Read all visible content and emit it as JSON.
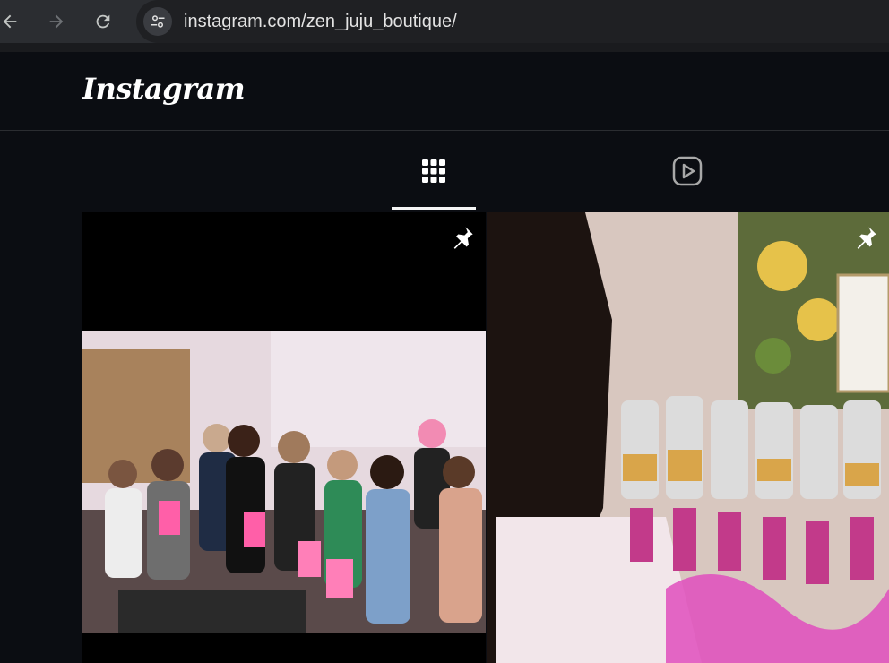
{
  "browser": {
    "url": "instagram.com/zen_juju_boutique/",
    "back_icon": "back-arrow-icon",
    "forward_icon": "forward-arrow-icon",
    "reload_icon": "reload-icon",
    "site_info_icon": "site-info-tune-icon"
  },
  "header": {
    "logo_text": "Instagram"
  },
  "tabs": [
    {
      "name": "posts",
      "icon": "grid-icon",
      "active": true
    },
    {
      "name": "reels",
      "icon": "reels-play-icon",
      "active": false
    }
  ],
  "posts": [
    {
      "pinned": true,
      "icon": "pin-icon",
      "description_visual": "group photo"
    },
    {
      "pinned": true,
      "icon": "pin-icon",
      "description_visual": "perfume bar"
    }
  ],
  "colors": {
    "background": "#0b0d12",
    "chrome": "#2b2d31",
    "urlbar": "#1f2023",
    "text": "#e3e3e3"
  }
}
